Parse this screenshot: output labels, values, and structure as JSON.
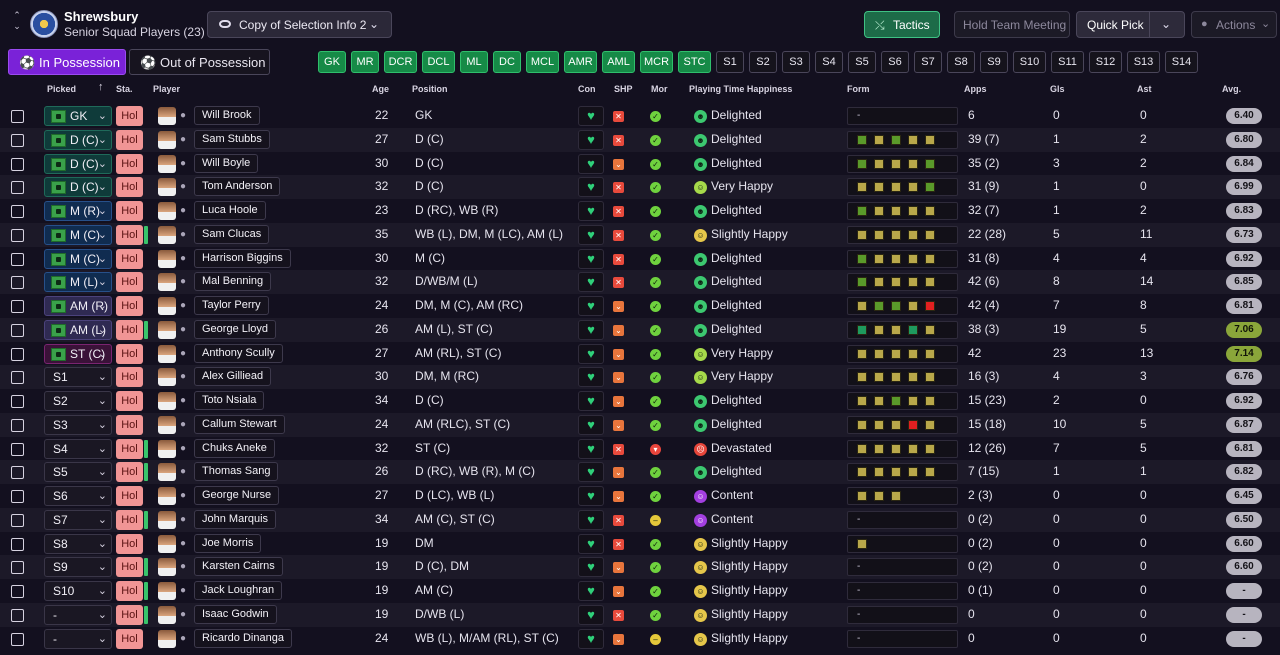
{
  "header": {
    "club_name": "Shrewsbury",
    "squad": "Senior Squad Players (23)",
    "view_select": "Copy of Selection Info 2",
    "tactics_label": "Tactics",
    "meeting_label": "Hold Team Meeting",
    "quick_pick_label": "Quick Pick",
    "actions_label": "Actions"
  },
  "possession_tabs": [
    "In Possession",
    "Out of Possession"
  ],
  "position_chips": [
    {
      "label": "GK",
      "on": true
    },
    {
      "label": "MR",
      "on": true
    },
    {
      "label": "DCR",
      "on": true
    },
    {
      "label": "DCL",
      "on": true
    },
    {
      "label": "ML",
      "on": true
    },
    {
      "label": "DC",
      "on": true
    },
    {
      "label": "MCL",
      "on": true
    },
    {
      "label": "AMR",
      "on": true
    },
    {
      "label": "AML",
      "on": true
    },
    {
      "label": "MCR",
      "on": true
    },
    {
      "label": "STC",
      "on": true
    },
    {
      "label": "S1",
      "on": false
    },
    {
      "label": "S2",
      "on": false
    },
    {
      "label": "S3",
      "on": false
    },
    {
      "label": "S4",
      "on": false
    },
    {
      "label": "S5",
      "on": false
    },
    {
      "label": "S6",
      "on": false
    },
    {
      "label": "S7",
      "on": false
    },
    {
      "label": "S8",
      "on": false
    },
    {
      "label": "S9",
      "on": false
    },
    {
      "label": "S10",
      "on": false
    },
    {
      "label": "S11",
      "on": false
    },
    {
      "label": "S12",
      "on": false
    },
    {
      "label": "S13",
      "on": false
    },
    {
      "label": "S14",
      "on": false
    }
  ],
  "columns": {
    "picked": "Picked",
    "sta": "Sta.",
    "player": "Player",
    "age": "Age",
    "position": "Position",
    "con": "Con",
    "shp": "SHP",
    "mor": "Mor",
    "happiness": "Playing Time Happiness",
    "form": "Form",
    "apps": "Apps",
    "gls": "Gls",
    "ast": "Ast",
    "avg": "Avg."
  },
  "colors": {
    "accent_purple": "#7a22d8",
    "chip_green": "#168a47",
    "status_pink": "#f19595"
  },
  "players": [
    {
      "picked": "GK",
      "pitch": true,
      "pick_style": "gk",
      "sta": "Hol",
      "bar": false,
      "name": "Will Brook",
      "age": "22",
      "position": "GK",
      "shp": "x",
      "mor": "g",
      "hap": "Delighted",
      "form": [],
      "apps": "6",
      "gls": "0",
      "ast": "0",
      "avg": "6.40",
      "avg_hi": false
    },
    {
      "picked": "D (C)",
      "pitch": true,
      "pick_style": "d",
      "sta": "Hol",
      "bar": false,
      "name": "Sam Stubbs",
      "age": "27",
      "position": "D (C)",
      "shp": "x",
      "mor": "g",
      "hap": "Delighted",
      "form": [
        "g",
        "a",
        "g",
        "a",
        "a"
      ],
      "apps": "39 (7)",
      "gls": "1",
      "ast": "2",
      "avg": "6.80",
      "avg_hi": false
    },
    {
      "picked": "D (C)",
      "pitch": true,
      "pick_style": "d",
      "sta": "Hol",
      "bar": false,
      "name": "Will Boyle",
      "age": "30",
      "position": "D (C)",
      "shp": "v",
      "mor": "g",
      "hap": "Delighted",
      "form": [
        "g",
        "a",
        "a",
        "a",
        "g"
      ],
      "apps": "35 (2)",
      "gls": "3",
      "ast": "2",
      "avg": "6.84",
      "avg_hi": false
    },
    {
      "picked": "D (C)",
      "pitch": true,
      "pick_style": "d",
      "sta": "Hol",
      "bar": false,
      "name": "Tom Anderson",
      "age": "32",
      "position": "D (C)",
      "shp": "x",
      "mor": "g",
      "hap": "Very Happy",
      "form": [
        "a",
        "a",
        "a",
        "a",
        "g"
      ],
      "apps": "31 (9)",
      "gls": "1",
      "ast": "0",
      "avg": "6.99",
      "avg_hi": false
    },
    {
      "picked": "M (R)",
      "pitch": true,
      "pick_style": "m",
      "sta": "Hol",
      "bar": false,
      "name": "Luca Hoole",
      "age": "23",
      "position": "D (RC), WB (R)",
      "shp": "x",
      "mor": "g",
      "hap": "Delighted",
      "form": [
        "g",
        "a",
        "a",
        "a",
        "a"
      ],
      "apps": "32 (7)",
      "gls": "1",
      "ast": "2",
      "avg": "6.83",
      "avg_hi": false
    },
    {
      "picked": "M (C)",
      "pitch": true,
      "pick_style": "m",
      "sta": "Hol",
      "bar": true,
      "name": "Sam Clucas",
      "age": "35",
      "position": "WB (L), DM, M (LC), AM (L)",
      "shp": "x",
      "mor": "g",
      "hap": "Slightly Happy",
      "form": [
        "a",
        "a",
        "a",
        "a",
        "a"
      ],
      "apps": "22 (28)",
      "gls": "5",
      "ast": "11",
      "avg": "6.73",
      "avg_hi": false
    },
    {
      "picked": "M (C)",
      "pitch": true,
      "pick_style": "m",
      "sta": "Hol",
      "bar": false,
      "name": "Harrison Biggins",
      "age": "30",
      "position": "M (C)",
      "shp": "x",
      "mor": "g",
      "hap": "Delighted",
      "form": [
        "g",
        "a",
        "a",
        "a",
        "a"
      ],
      "apps": "31 (8)",
      "gls": "4",
      "ast": "4",
      "avg": "6.92",
      "avg_hi": false
    },
    {
      "picked": "M (L)",
      "pitch": true,
      "pick_style": "m",
      "sta": "Hol",
      "bar": false,
      "name": "Mal Benning",
      "age": "32",
      "position": "D/WB/M (L)",
      "shp": "x",
      "mor": "g",
      "hap": "Delighted",
      "form": [
        "g",
        "a",
        "a",
        "a",
        "a"
      ],
      "apps": "42 (6)",
      "gls": "8",
      "ast": "14",
      "avg": "6.85",
      "avg_hi": false
    },
    {
      "picked": "AM (R)",
      "pitch": true,
      "pick_style": "am",
      "sta": "Hol",
      "bar": false,
      "name": "Taylor Perry",
      "age": "24",
      "position": "DM, M (C), AM (RC)",
      "shp": "v",
      "mor": "g",
      "hap": "Delighted",
      "form": [
        "a",
        "g",
        "g",
        "a",
        "r"
      ],
      "apps": "42 (4)",
      "gls": "7",
      "ast": "8",
      "avg": "6.81",
      "avg_hi": false
    },
    {
      "picked": "AM (L)",
      "pitch": true,
      "pick_style": "am",
      "sta": "Hol",
      "bar": true,
      "name": "George Lloyd",
      "age": "26",
      "position": "AM (L), ST (C)",
      "shp": "v",
      "mor": "g",
      "hap": "Delighted",
      "form": [
        "t",
        "a",
        "a",
        "t",
        "a"
      ],
      "apps": "38 (3)",
      "gls": "19",
      "ast": "5",
      "avg": "7.06",
      "avg_hi": true
    },
    {
      "picked": "ST (C)",
      "pitch": true,
      "pick_style": "st",
      "sta": "Hol",
      "bar": false,
      "name": "Anthony Scully",
      "age": "27",
      "position": "AM (RL), ST (C)",
      "shp": "v",
      "mor": "g",
      "hap": "Very Happy",
      "form": [
        "a",
        "a",
        "a",
        "a",
        "a"
      ],
      "apps": "42",
      "gls": "23",
      "ast": "13",
      "avg": "7.14",
      "avg_hi": true
    },
    {
      "picked": "S1",
      "pitch": false,
      "pick_style": "plain",
      "sta": "Hol",
      "bar": false,
      "name": "Alex Gilliead",
      "age": "30",
      "position": "DM, M (RC)",
      "shp": "v",
      "mor": "g",
      "hap": "Very Happy",
      "form": [
        "a",
        "a",
        "a",
        "a",
        "a"
      ],
      "apps": "16 (3)",
      "gls": "4",
      "ast": "3",
      "avg": "6.76",
      "avg_hi": false
    },
    {
      "picked": "S2",
      "pitch": false,
      "pick_style": "plain",
      "sta": "Hol",
      "bar": false,
      "name": "Toto Nsiala",
      "age": "34",
      "position": "D (C)",
      "shp": "v",
      "mor": "g",
      "hap": "Delighted",
      "form": [
        "a",
        "a",
        "g",
        "a",
        "a"
      ],
      "apps": "15 (23)",
      "gls": "2",
      "ast": "0",
      "avg": "6.92",
      "avg_hi": false
    },
    {
      "picked": "S3",
      "pitch": false,
      "pick_style": "plain",
      "sta": "Hol",
      "bar": false,
      "name": "Callum Stewart",
      "age": "24",
      "position": "AM (RLC), ST (C)",
      "shp": "v",
      "mor": "g",
      "hap": "Delighted",
      "form": [
        "a",
        "a",
        "a",
        "r",
        "a"
      ],
      "apps": "15 (18)",
      "gls": "10",
      "ast": "5",
      "avg": "6.87",
      "avg_hi": false
    },
    {
      "picked": "S4",
      "pitch": false,
      "pick_style": "plain",
      "sta": "Hol",
      "bar": true,
      "name": "Chuks Aneke",
      "age": "32",
      "position": "ST (C)",
      "shp": "x",
      "mor": "r",
      "hap": "Devastated",
      "form": [
        "a",
        "a",
        "a",
        "a",
        "a"
      ],
      "apps": "12 (26)",
      "gls": "7",
      "ast": "5",
      "avg": "6.81",
      "avg_hi": false
    },
    {
      "picked": "S5",
      "pitch": false,
      "pick_style": "plain",
      "sta": "Hol",
      "bar": true,
      "name": "Thomas Sang",
      "age": "26",
      "position": "D (RC), WB (R), M (C)",
      "shp": "v",
      "mor": "g",
      "hap": "Delighted",
      "form": [
        "a",
        "a",
        "a",
        "a",
        "a"
      ],
      "apps": "7 (15)",
      "gls": "1",
      "ast": "1",
      "avg": "6.82",
      "avg_hi": false
    },
    {
      "picked": "S6",
      "pitch": false,
      "pick_style": "plain",
      "sta": "Hol",
      "bar": false,
      "name": "George Nurse",
      "age": "27",
      "position": "D (LC), WB (L)",
      "shp": "v",
      "mor": "g",
      "hap": "Content",
      "form": [
        "a",
        "a",
        "a"
      ],
      "apps": "2 (3)",
      "gls": "0",
      "ast": "0",
      "avg": "6.45",
      "avg_hi": false
    },
    {
      "picked": "S7",
      "pitch": false,
      "pick_style": "plain",
      "sta": "Hol",
      "bar": true,
      "name": "John Marquis",
      "age": "34",
      "position": "AM (C), ST (C)",
      "shp": "x",
      "mor": "y",
      "hap": "Content",
      "form": [],
      "apps": "0 (2)",
      "gls": "0",
      "ast": "0",
      "avg": "6.50",
      "avg_hi": false
    },
    {
      "picked": "S8",
      "pitch": false,
      "pick_style": "plain",
      "sta": "Hol",
      "bar": false,
      "name": "Joe Morris",
      "age": "19",
      "position": "DM",
      "shp": "x",
      "mor": "g",
      "hap": "Slightly Happy",
      "form": [
        "a"
      ],
      "apps": "0 (2)",
      "gls": "0",
      "ast": "0",
      "avg": "6.60",
      "avg_hi": false
    },
    {
      "picked": "S9",
      "pitch": false,
      "pick_style": "plain",
      "sta": "Hol",
      "bar": true,
      "name": "Karsten Cairns",
      "age": "19",
      "position": "D (C), DM",
      "shp": "v",
      "mor": "g",
      "hap": "Slightly Happy",
      "form": [],
      "apps": "0 (2)",
      "gls": "0",
      "ast": "0",
      "avg": "6.60",
      "avg_hi": false
    },
    {
      "picked": "S10",
      "pitch": false,
      "pick_style": "plain",
      "sta": "Hol",
      "bar": true,
      "name": "Jack Loughran",
      "age": "19",
      "position": "AM (C)",
      "shp": "v",
      "mor": "g",
      "hap": "Slightly Happy",
      "form": [],
      "apps": "0 (1)",
      "gls": "0",
      "ast": "0",
      "avg": "-",
      "avg_hi": false
    },
    {
      "picked": "-",
      "pitch": false,
      "pick_style": "plain",
      "sta": "Hol",
      "bar": true,
      "name": "Isaac Godwin",
      "age": "19",
      "position": "D/WB (L)",
      "shp": "x",
      "mor": "g",
      "hap": "Slightly Happy",
      "form": [],
      "apps": "0",
      "gls": "0",
      "ast": "0",
      "avg": "-",
      "avg_hi": false
    },
    {
      "picked": "-",
      "pitch": false,
      "pick_style": "plain",
      "sta": "Hol",
      "bar": false,
      "name": "Ricardo Dinanga",
      "age": "24",
      "position": "WB (L), M/AM (RL), ST (C)",
      "shp": "v",
      "mor": "y",
      "hap": "Slightly Happy",
      "form": [],
      "apps": "0",
      "gls": "0",
      "ast": "0",
      "avg": "-",
      "avg_hi": false
    }
  ]
}
